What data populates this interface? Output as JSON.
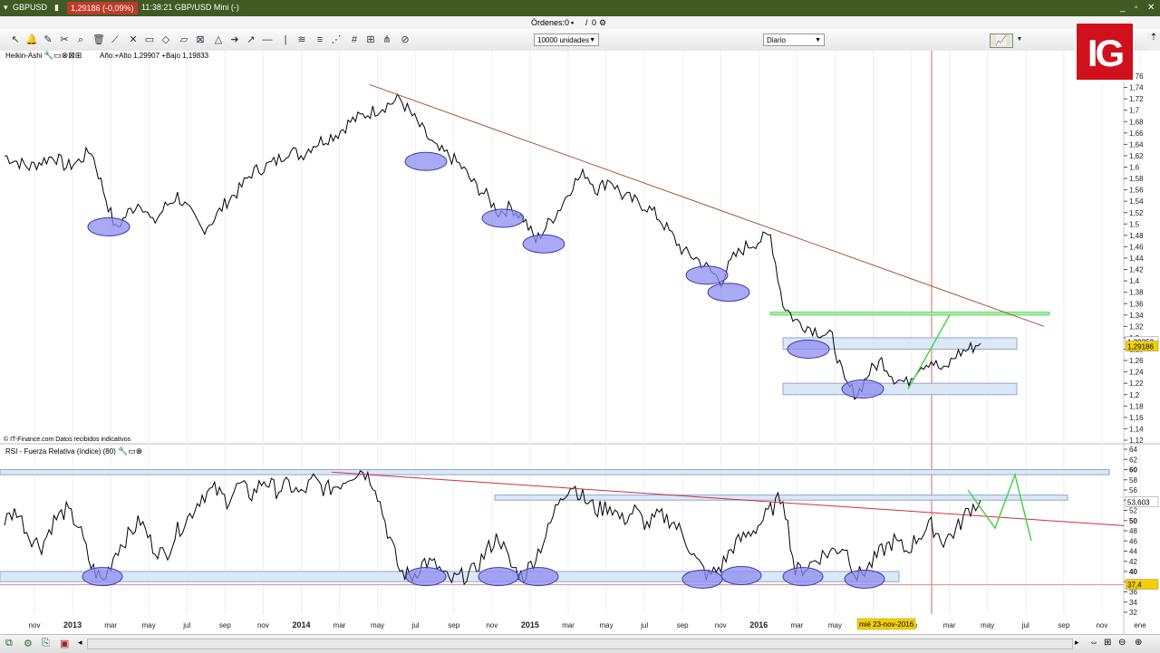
{
  "window": {
    "symbol": "GBPUSD",
    "price_badge": "1,29186 (-0,09%)",
    "time_info": "11:38:21 GBP/USD Mini (-)"
  },
  "orders_bar": {
    "label": "Órdenes:",
    "value1": "0",
    "sep": "/",
    "value2": "0"
  },
  "toolbar": {
    "units_select": "10000 unidades",
    "period_select": "Diario"
  },
  "logo": {
    "text": "IG"
  },
  "price_panel": {
    "indicator_label": "Heikin-Ashi",
    "stats": "Año:+Alto 1,29907 +Bajo 1,19833",
    "source_note": "© IT-Finance.com  Datos recibidos indicativos"
  },
  "rsi_panel": {
    "label": "RSI - Fuerza Relativa (índice) (80)"
  },
  "cursor_date": "mié 23-nov-2016",
  "chart_data": [
    {
      "type": "line",
      "title": "",
      "xlabel": "",
      "ylabel": "",
      "x_tick_labels": [
        "nov",
        "2013",
        "mar",
        "may",
        "jul",
        "sep",
        "nov",
        "2014",
        "mar",
        "may",
        "jul",
        "sep",
        "nov",
        "2015",
        "mar",
        "may",
        "jul",
        "sep",
        "nov",
        "2016",
        "mar",
        "may",
        "jul",
        "sep",
        "mar",
        "may",
        "jul",
        "sep",
        "nov",
        "ene"
      ],
      "y_ticks": [
        "1,76",
        "1,74",
        "1,72",
        "1,7",
        "1,68",
        "1,66",
        "1,64",
        "1,62",
        "1,6",
        "1,58",
        "1,56",
        "1,54",
        "1,52",
        "1,5",
        "1,48",
        "1,46",
        "1,44",
        "1,42",
        "1,4",
        "1,38",
        "1,36",
        "1,34",
        "1,32",
        "1,3",
        "1,28",
        "1,26",
        "1,24",
        "1,22",
        "1,2",
        "1,18",
        "1,16",
        "1,14",
        "1,12"
      ],
      "ylim": [
        1.12,
        1.76
      ],
      "last_price": "1,29186",
      "crosshair_price": "1,29252",
      "series": [
        {
          "values": [
            1.62,
            1.61,
            1.6,
            1.61,
            1.62,
            1.6,
            1.61,
            1.63,
            1.56,
            1.49,
            1.52,
            1.54,
            1.5,
            1.53,
            1.55,
            1.52,
            1.49,
            1.51,
            1.54,
            1.56,
            1.59,
            1.6,
            1.61,
            1.63,
            1.62,
            1.64,
            1.65,
            1.66,
            1.68,
            1.69,
            1.7,
            1.71,
            1.72,
            1.69,
            1.66,
            1.63,
            1.62,
            1.6,
            1.57,
            1.55,
            1.52,
            1.53,
            1.51,
            1.47,
            1.5,
            1.53,
            1.57,
            1.59,
            1.56,
            1.58,
            1.55,
            1.54,
            1.53,
            1.51,
            1.48,
            1.45,
            1.44,
            1.42,
            1.4,
            1.44,
            1.46,
            1.47,
            1.48,
            1.36,
            1.33,
            1.32,
            1.31,
            1.3,
            1.22,
            1.2,
            1.24,
            1.26,
            1.23,
            1.22,
            1.25,
            1.26,
            1.24,
            1.27,
            1.28,
            1.29
          ]
        }
      ],
      "annotations": [
        {
          "type": "trendline",
          "x": [
            0.33,
            0.93
          ],
          "y": [
            1.74,
            1.32
          ]
        },
        {
          "type": "zone",
          "y": [
            1.34,
            1.345
          ]
        },
        {
          "type": "zone",
          "y": [
            1.28,
            1.3
          ]
        },
        {
          "type": "zone",
          "y": [
            1.2,
            1.22
          ]
        },
        {
          "type": "projection-arrow",
          "y": [
            1.22,
            1.34
          ]
        }
      ]
    },
    {
      "type": "line",
      "title": "",
      "y_ticks": [
        "64",
        "62",
        "60",
        "58",
        "56",
        "54",
        "52",
        "50",
        "48",
        "46",
        "44",
        "42",
        "40",
        "38",
        "36",
        "34",
        "32"
      ],
      "ylim": [
        32,
        64
      ],
      "last_value": "53,603",
      "crosshair_value": "37,4",
      "series": [
        {
          "values": [
            50,
            52,
            47,
            45,
            50,
            52,
            49,
            41,
            38,
            44,
            47,
            50,
            45,
            43,
            48,
            51,
            55,
            56,
            54,
            57,
            55,
            58,
            56,
            57,
            55,
            58,
            56,
            57,
            59,
            60,
            57,
            48,
            40,
            39,
            42,
            41,
            38,
            39,
            40,
            44,
            47,
            41,
            39,
            43,
            48,
            55,
            57,
            54,
            52,
            53,
            50,
            52,
            49,
            51,
            50,
            47,
            42,
            39,
            41,
            45,
            47,
            49,
            52,
            55,
            40,
            41,
            43,
            44,
            45,
            39,
            41,
            44,
            46,
            44,
            47,
            49,
            46,
            48,
            52,
            54
          ]
        }
      ],
      "annotations": [
        {
          "type": "trendline",
          "y": [
            58,
            49
          ]
        },
        {
          "type": "zone",
          "y": [
            59,
            60
          ]
        },
        {
          "type": "zone",
          "y": [
            54,
            55
          ]
        },
        {
          "type": "zone",
          "y": [
            38,
            40
          ]
        },
        {
          "type": "projection-arrow",
          "y": [
            54,
            49,
            59,
            46
          ]
        }
      ]
    }
  ]
}
